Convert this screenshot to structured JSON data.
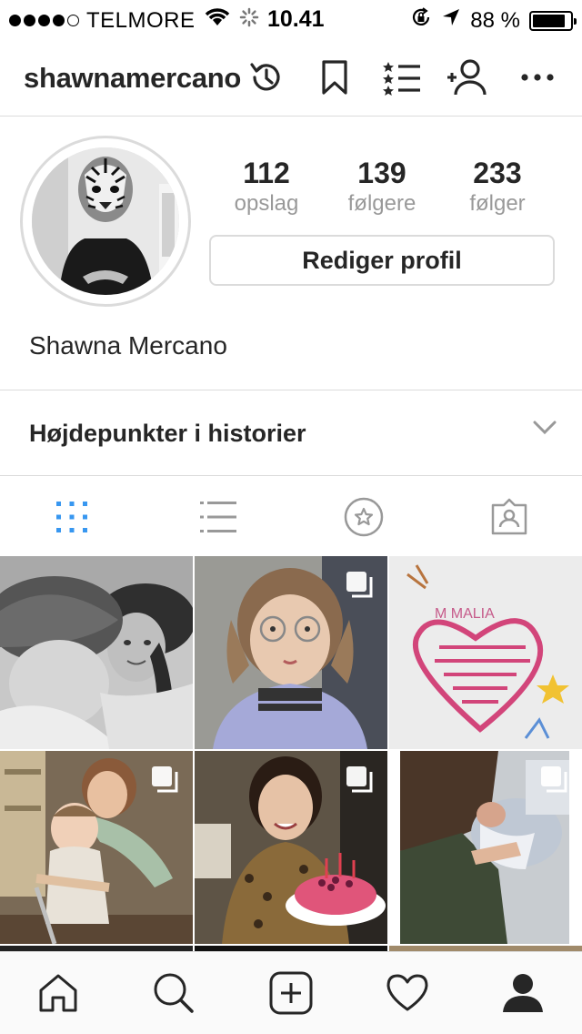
{
  "status_bar": {
    "carrier": "TELMORE",
    "time": "10.41",
    "battery_text": "88 %",
    "battery_level": 0.88
  },
  "header": {
    "username": "shawnamercano",
    "icons": [
      "archive-history-icon",
      "bookmark-icon",
      "close-friends-list-icon",
      "add-person-icon",
      "more-icon"
    ]
  },
  "profile": {
    "posts_count": "112",
    "posts_label": "opslag",
    "followers_count": "139",
    "followers_label": "følgere",
    "following_count": "233",
    "following_label": "følger",
    "edit_button": "Rediger profil",
    "full_name": "Shawna Mercano"
  },
  "highlights": {
    "label": "Højdepunkter i historier"
  },
  "tabs": {
    "items": [
      "grid-icon",
      "list-icon",
      "star-icon",
      "tagged-icon"
    ],
    "active": "grid-icon",
    "active_color": "#3897f0"
  },
  "grid": {
    "posts": [
      {
        "name": "post-child-hat",
        "multi": false
      },
      {
        "name": "post-girl-glasses",
        "multi": true
      },
      {
        "name": "post-drawing-heart",
        "multi": false
      },
      {
        "name": "post-kids-scooter",
        "multi": true
      },
      {
        "name": "post-woman-cake",
        "multi": true
      },
      {
        "name": "post-newborn",
        "multi": true
      }
    ]
  },
  "bottom_nav": {
    "items": [
      "home-icon",
      "search-icon",
      "add-post-icon",
      "activity-heart-icon",
      "profile-icon"
    ]
  }
}
